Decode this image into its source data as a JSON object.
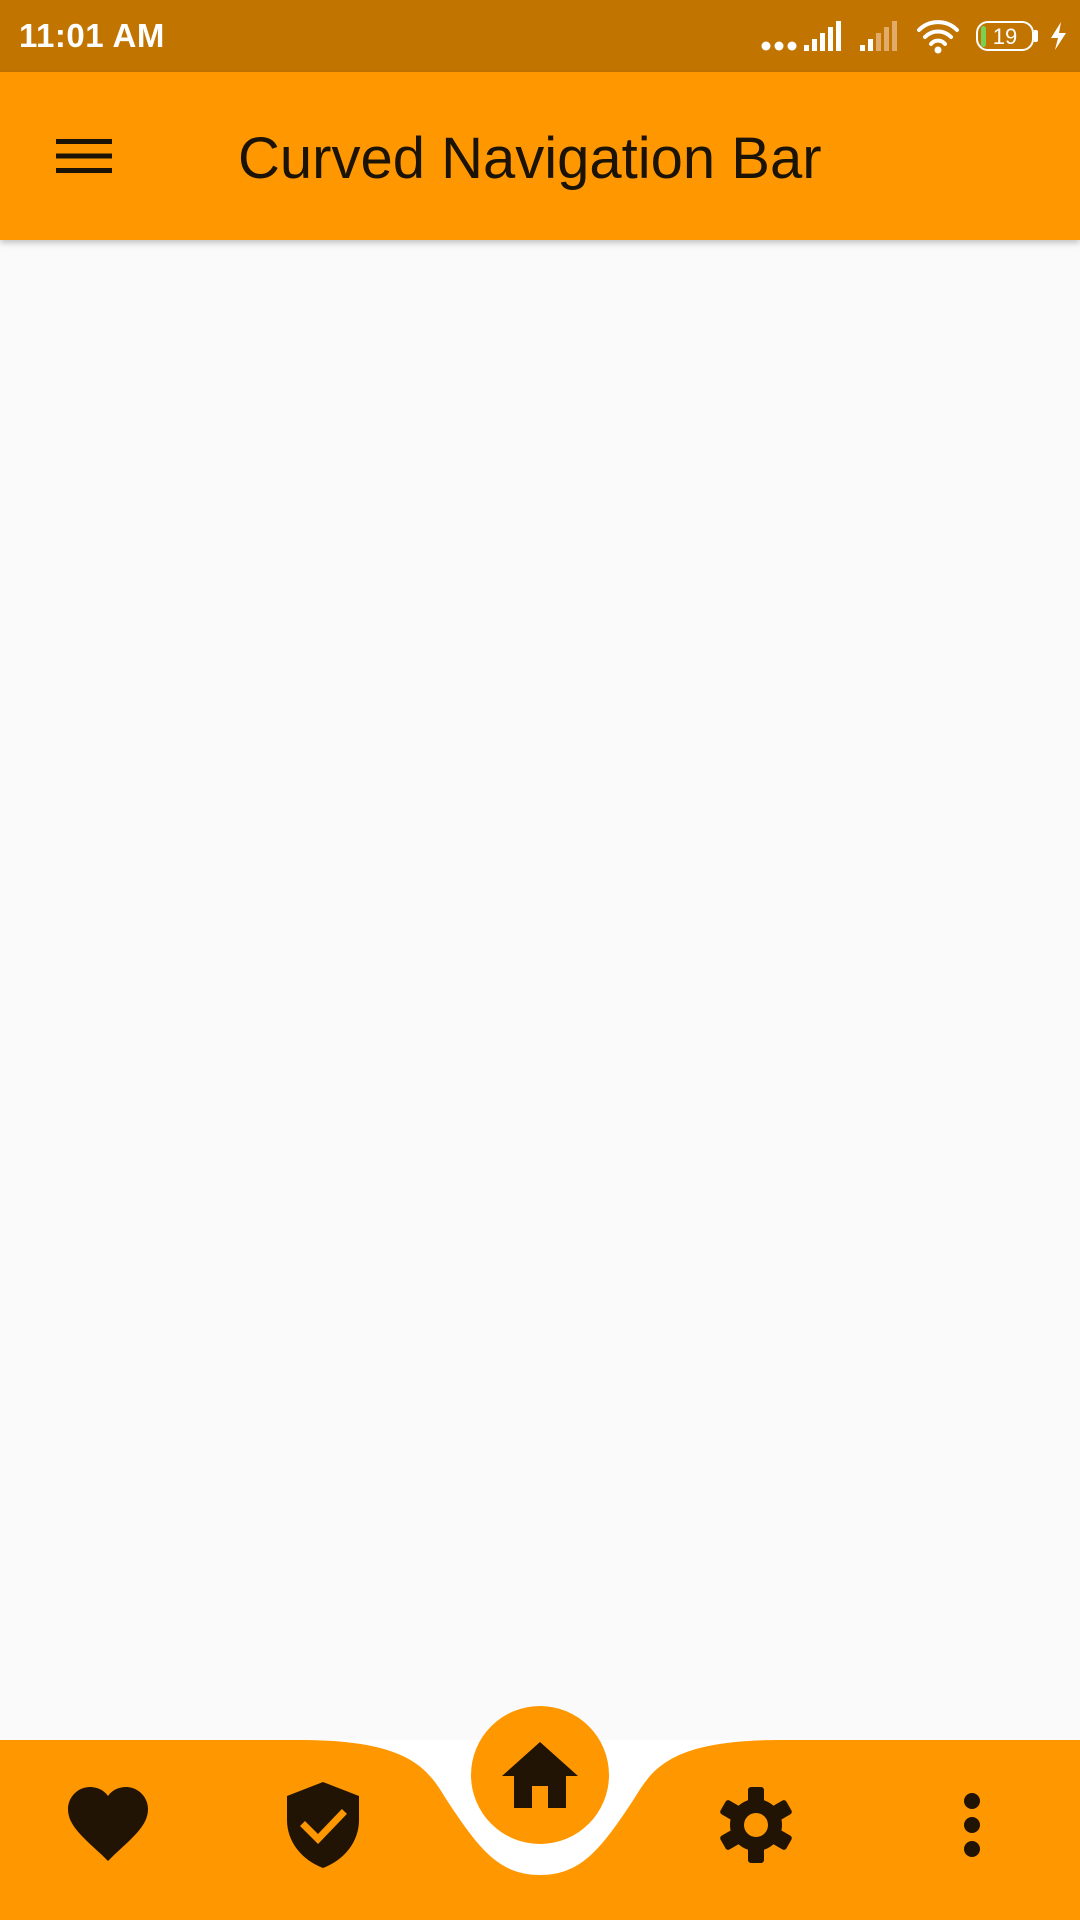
{
  "status_bar": {
    "time": "11:01 AM",
    "battery_level": "19",
    "icons": [
      "more-dots-icon",
      "signal-icon",
      "signal-weak-icon",
      "wifi-icon",
      "battery-icon",
      "charging-icon"
    ]
  },
  "app_bar": {
    "title": "Curved Navigation Bar",
    "menu_icon": "menu-icon"
  },
  "bottom_nav": {
    "items": [
      {
        "icon": "heart-icon"
      },
      {
        "icon": "shield-check-icon"
      },
      {
        "icon": "home-icon",
        "selected": true
      },
      {
        "icon": "gear-icon"
      },
      {
        "icon": "more-vertical-icon"
      }
    ]
  },
  "colors": {
    "status_bar": "#c17400",
    "primary": "#ff9800",
    "icon": "#221405",
    "background": "#fafafa",
    "nav_background": "#ffffff"
  }
}
